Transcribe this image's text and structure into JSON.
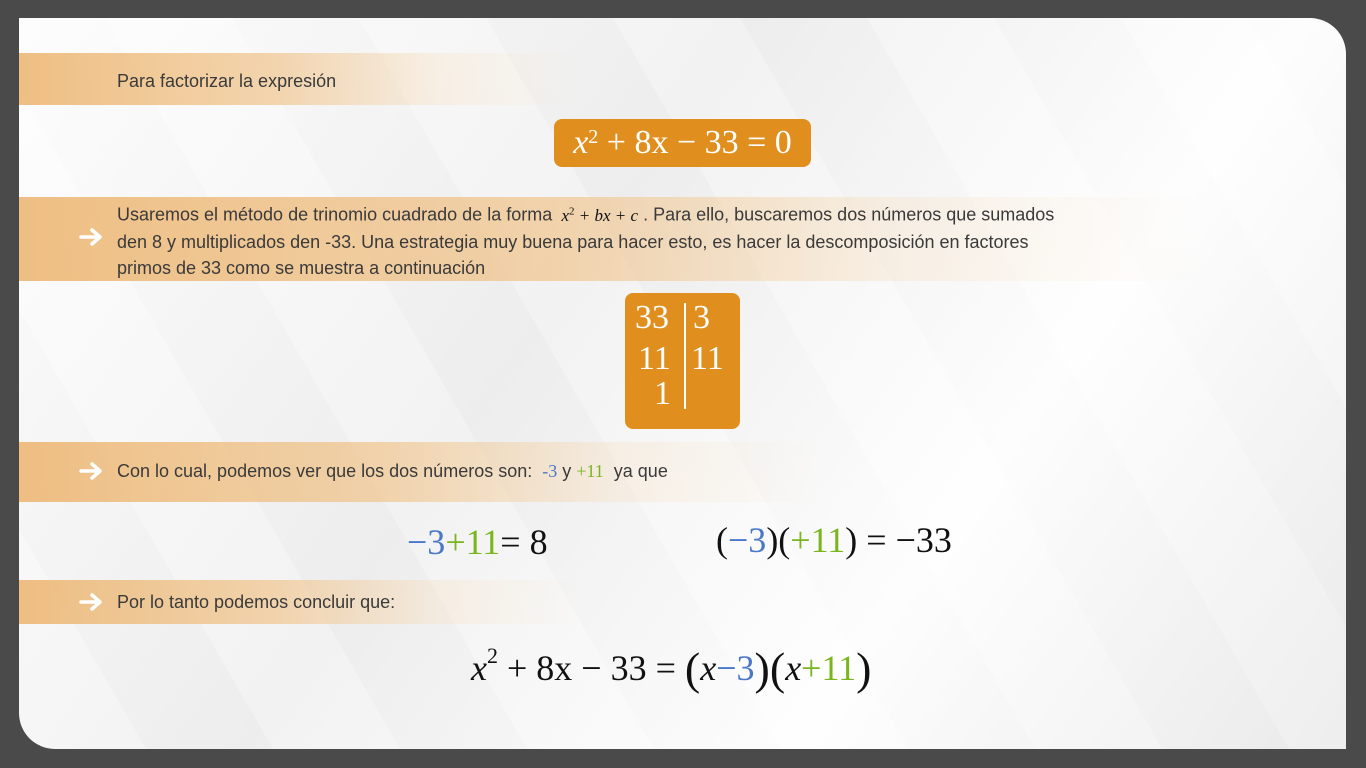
{
  "intro": {
    "text": "Para factorizar la expresión"
  },
  "main_equation": {
    "x": "x",
    "exp": "2",
    "rest": "+ 8x − 33 = 0"
  },
  "method": {
    "line1_a": "Usaremos el método de trinomio cuadrado de la forma",
    "form_x": "x",
    "form_exp": "2",
    "form_rest": "+ bx + c",
    "line1_b": ". Para ello, buscaremos dos números que sumados",
    "line2": "den 8 y multiplicados den -33. Una estrategia muy buena para hacer esto, es hacer la descomposición en factores",
    "line3": "primos de 33 como se muestra a continuación"
  },
  "factorization": {
    "left": [
      "33",
      "11",
      "1"
    ],
    "right": [
      "3",
      "11"
    ]
  },
  "numbers": {
    "text_a": "Con lo cual, podemos ver que los dos números son:",
    "n1": "-3",
    "y": "y",
    "n2": "+11",
    "text_b": "ya que"
  },
  "sum_eq": {
    "a": "−3",
    "b": "+11",
    "c": "= 8"
  },
  "prod_eq": {
    "open1": "(",
    "a": "−3",
    "close1": ")(",
    "b": "+11",
    "close2": ")",
    "c": "= −33"
  },
  "conclusion": {
    "text": "Por lo tanto podemos concluir que:"
  },
  "final_eq": {
    "x": "x",
    "exp": "2",
    "rest": "+ 8x − 33 =",
    "p1_x": "x",
    "p1_n": "−3",
    "p2_x": "x",
    "p2_n": "+11"
  },
  "colors": {
    "accent": "#e08e1e",
    "blue": "#4a78c8",
    "green": "#7ab51d"
  },
  "icons": [
    "arrow-right-icon"
  ]
}
